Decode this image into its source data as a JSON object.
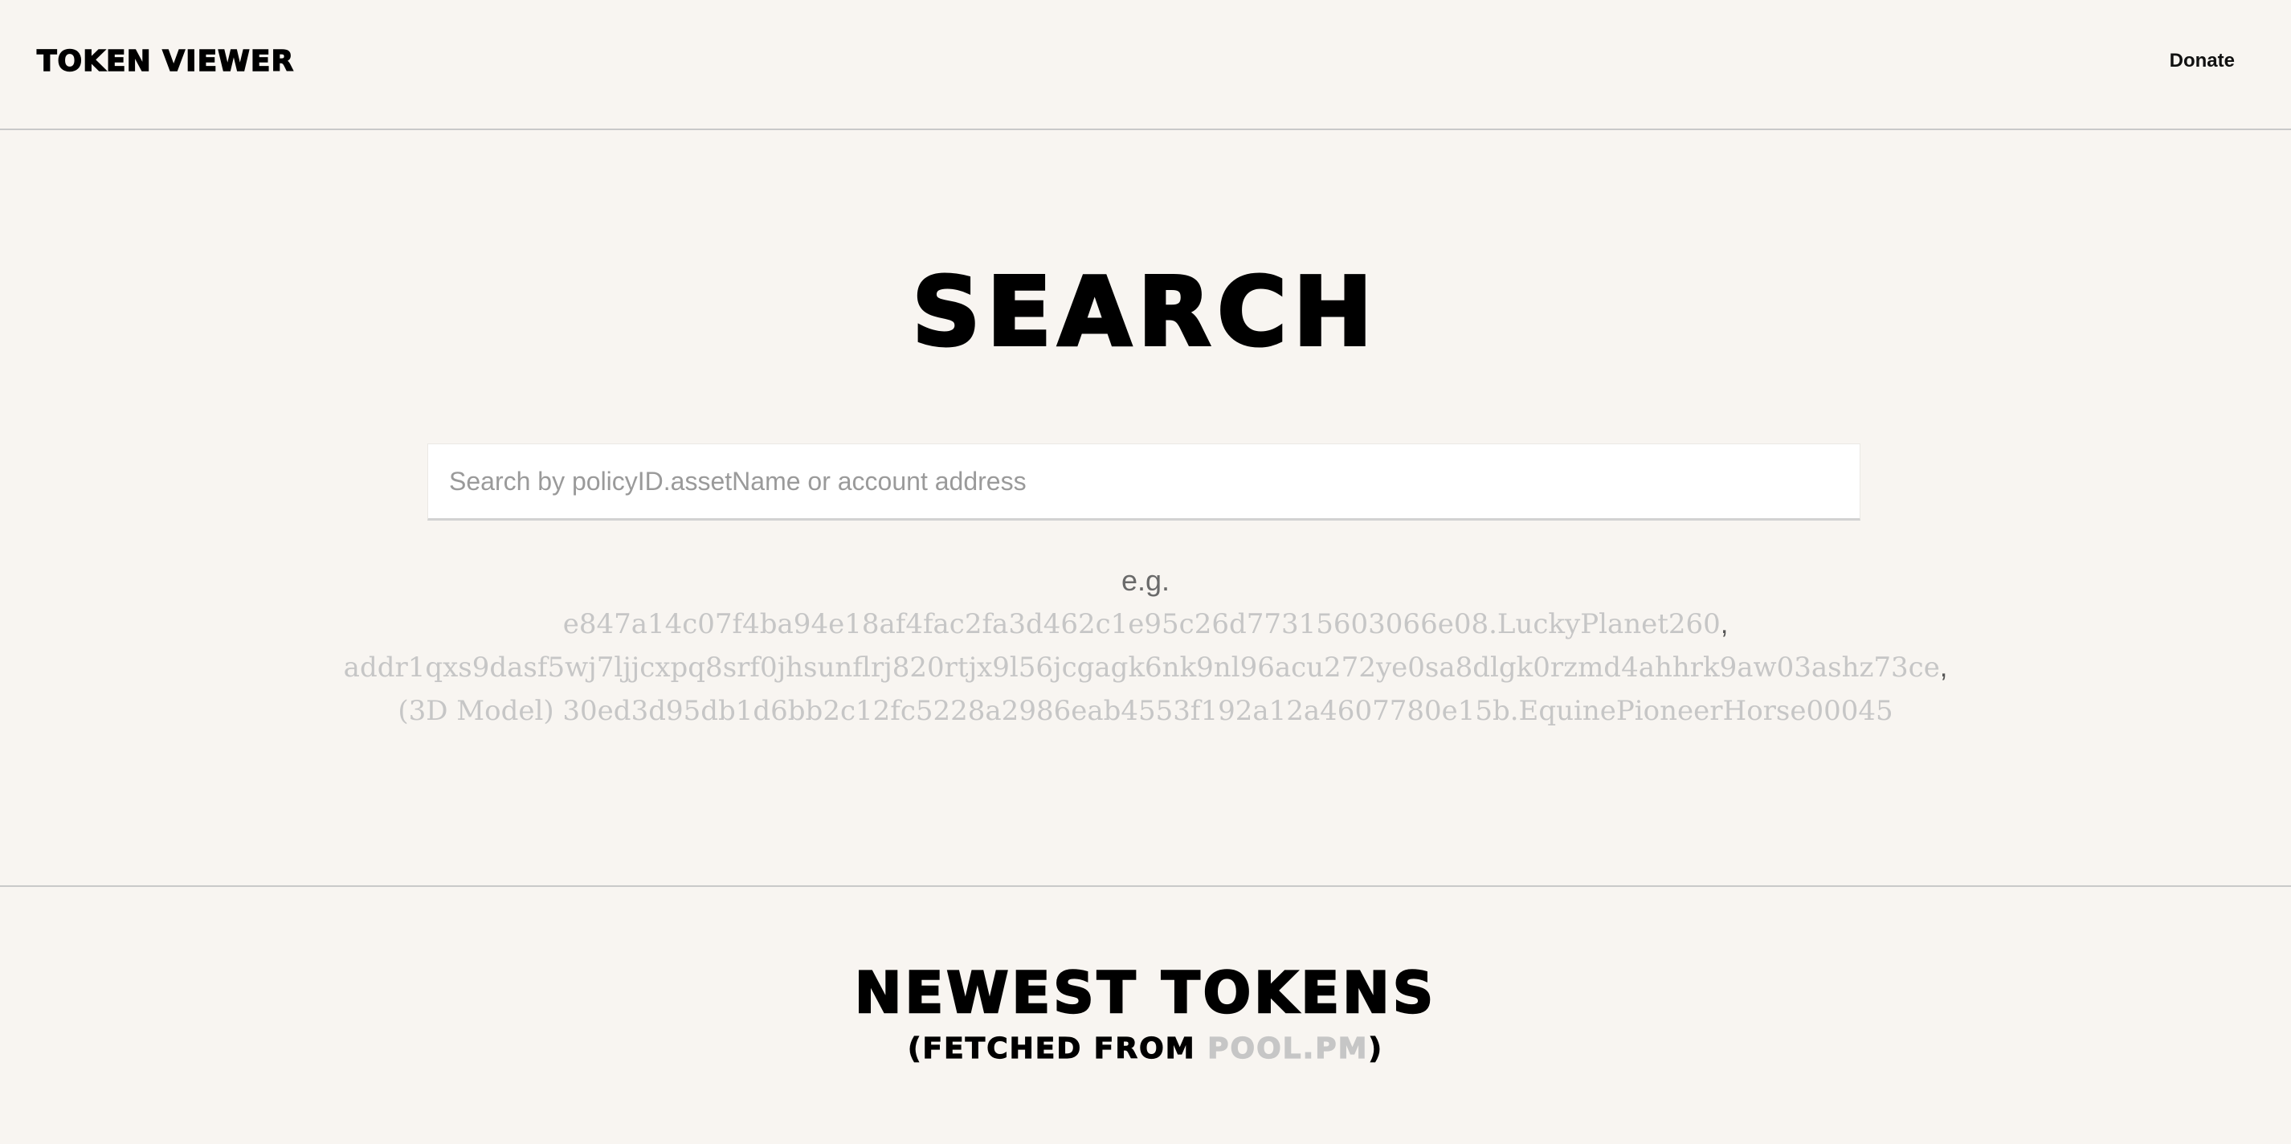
{
  "header": {
    "logo": "TOKEN VIEWER",
    "donate": "Donate"
  },
  "search": {
    "title": "SEARCH",
    "placeholder": "Search by policyID.assetName or account address",
    "value": "",
    "eg_label": "e.g.",
    "examples": [
      {
        "prefix": "",
        "text": "e847a14c07f4ba94e18af4fac2fa3d462c1e95c26d77315603066e08.LuckyPlanet260",
        "suffix": ","
      },
      {
        "prefix": "",
        "text": "addr1qxs9dasf5wj7ljjcxpq8srf0jhsunflrj820rtjx9l56jcgagk6nk9nl96acu272ye0sa8dlgk0rzmd4ahhrk9aw03ashz73ce",
        "suffix": ","
      },
      {
        "prefix": "",
        "text": "(3D Model) 30ed3d95db1d6bb2c12fc5228a2986eab4553f192a12a4607780e15b.EquinePioneerHorse00045",
        "suffix": ""
      }
    ]
  },
  "newest": {
    "title": "NEWEST TOKENS",
    "sub_open": "(FETCHED FROM ",
    "sub_link": "POOL.PM",
    "sub_close": ")"
  },
  "colors": {
    "background": "#f8f5f1",
    "link_muted": "#c6c6c6",
    "divider": "#c9c9c9"
  }
}
